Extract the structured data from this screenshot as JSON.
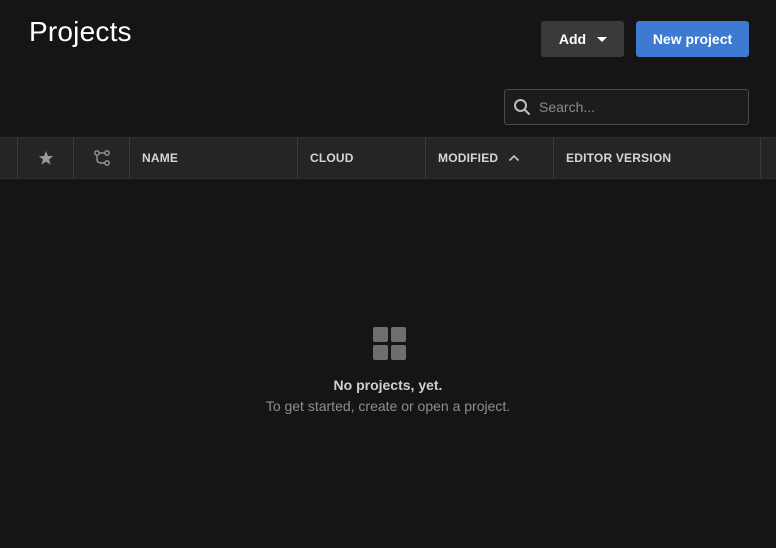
{
  "header": {
    "title": "Projects",
    "add_label": "Add",
    "new_project_label": "New project"
  },
  "search": {
    "placeholder": "Search..."
  },
  "table": {
    "columns": {
      "name": "NAME",
      "cloud": "CLOUD",
      "modified": "MODIFIED",
      "editor_version": "EDITOR VERSION"
    },
    "icons": {
      "favorite": "star-icon",
      "version_control": "version-control-icon",
      "sort": "sort-ascending-icon"
    }
  },
  "empty_state": {
    "icon": "grid-icon",
    "title": "No projects, yet.",
    "subtitle": "To get started, create or open a project."
  },
  "colors": {
    "background": "#161516",
    "accent": "#3e7ad2",
    "header_row": "#262526"
  }
}
